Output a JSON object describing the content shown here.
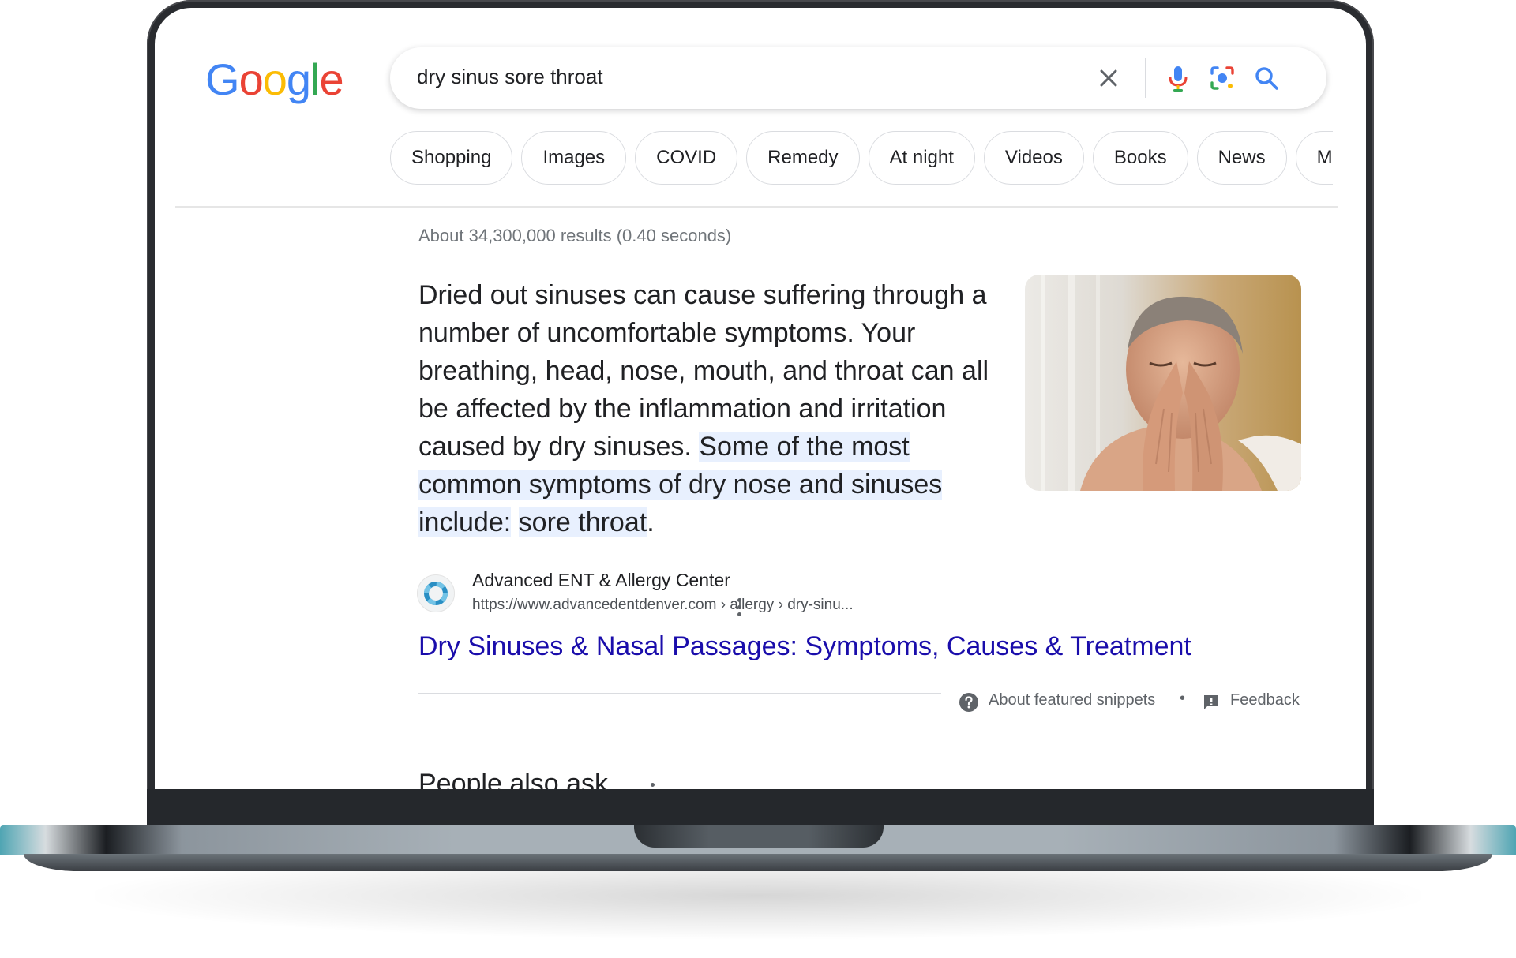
{
  "search": {
    "query": "dry sinus sore throat"
  },
  "logo": {
    "letters": [
      "G",
      "o",
      "o",
      "g",
      "l",
      "e"
    ]
  },
  "chips": [
    {
      "label": "Shopping"
    },
    {
      "label": "Images"
    },
    {
      "label": "COVID"
    },
    {
      "label": "Remedy"
    },
    {
      "label": "At night"
    },
    {
      "label": "Videos"
    },
    {
      "label": "Books"
    },
    {
      "label": "News"
    },
    {
      "label": "Maps"
    }
  ],
  "results": {
    "stats": "About 34,300,000 results (0.40 seconds)"
  },
  "featured_snippet": {
    "text_plain": "Dried out sinuses can cause suffering through a number of uncomfortable symptoms. Your breathing, head, nose, mouth, and throat can all be affected by the inflammation and irritation caused by dry sinuses.",
    "text_highlight_1": "Some of the most common symptoms of dry nose and sinuses include:",
    "text_highlight_2": "sore throat",
    "text_end": ".",
    "source_name": "Advanced ENT & Allergy Center",
    "source_url": "https://www.advancedentdenver.com › allergy › dry-sinu...",
    "link_title": "Dry Sinuses & Nasal Passages: Symptoms, Causes & Treatment",
    "about_label": "About featured snippets",
    "separator": "•",
    "feedback_label": "Feedback"
  },
  "people_also_ask": {
    "title": "People also ask"
  },
  "colors": {
    "link": "#1a0dab",
    "highlight": "#e8f0fe",
    "google_blue": "#4285F4",
    "google_red": "#EA4335",
    "google_yellow": "#FBBC05",
    "google_green": "#34A853"
  },
  "icons": {
    "clear": "close-icon",
    "voice": "microphone-icon",
    "lens": "camera-lens-icon",
    "search": "search-icon",
    "help": "question-circle-icon",
    "feedback": "feedback-icon",
    "more": "more-vert-icon"
  }
}
